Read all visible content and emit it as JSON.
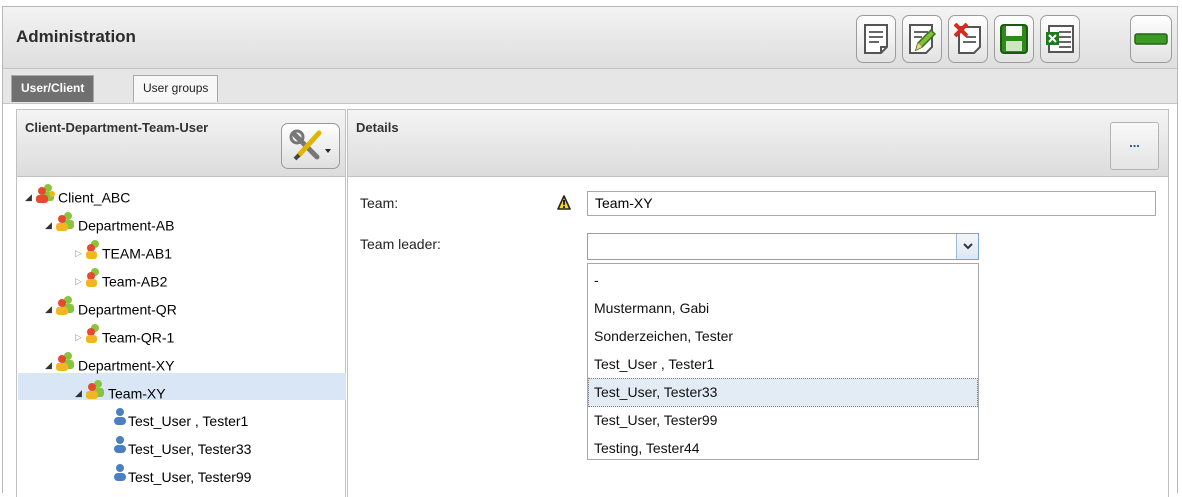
{
  "header": {
    "title": "Administration"
  },
  "toolbar": [
    "new-record-icon",
    "edit-record-icon",
    "delete-record-icon",
    "save-icon",
    "excel-export-icon",
    "minimize-icon"
  ],
  "tabs": [
    {
      "label": "User/Client",
      "active": true
    },
    {
      "label": "User groups",
      "active": false
    }
  ],
  "tree_panel": {
    "title": "Client-Department-Team-User",
    "tools_icon": "tools-icon",
    "nodes": [
      {
        "label": "Client_ABC",
        "type": "client",
        "expanded": true
      },
      {
        "label": "Department-AB",
        "type": "department",
        "expanded": true
      },
      {
        "label": "TEAM-AB1",
        "type": "team",
        "expanded": false
      },
      {
        "label": "Team-AB2",
        "type": "team",
        "expanded": false
      },
      {
        "label": "Department-QR",
        "type": "department",
        "expanded": true
      },
      {
        "label": "Team-QR-1",
        "type": "team",
        "expanded": false
      },
      {
        "label": "Department-XY",
        "type": "department",
        "expanded": true
      },
      {
        "label": "Team-XY",
        "type": "team-open",
        "expanded": true,
        "selected": true
      },
      {
        "label": "Test_User , Tester1",
        "type": "user"
      },
      {
        "label": "Test_User, Tester33",
        "type": "user"
      },
      {
        "label": "Test_User, Tester99",
        "type": "user"
      }
    ]
  },
  "details": {
    "title": "Details",
    "more_label": "...",
    "team_label": "Team:",
    "team_value": "Team-XY",
    "leader_label": "Team leader:",
    "leader_value": "",
    "leader_options": [
      "-",
      "Mustermann, Gabi",
      "Sonderzeichen, Tester",
      "Test_User , Tester1",
      "Test_User, Tester33",
      "Test_User, Tester99",
      "Testing, Tester44"
    ],
    "leader_highlighted": "Test_User, Tester33"
  },
  "colors": {
    "selection": "#d9e6f6",
    "accent": "#1a4f9a",
    "active_tab": "#707070"
  }
}
